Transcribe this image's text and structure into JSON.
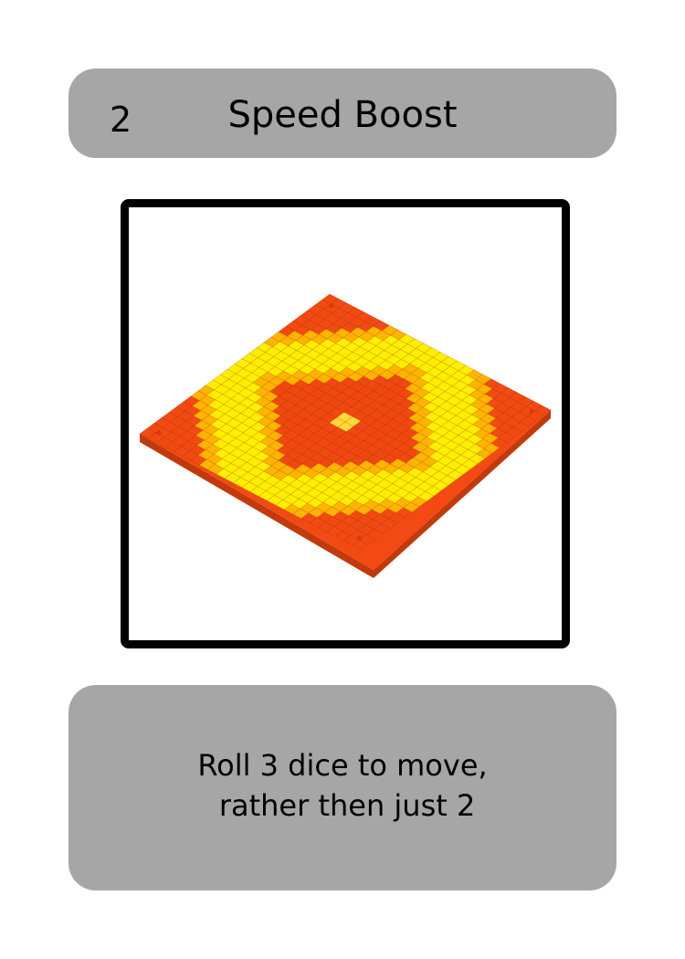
{
  "card": {
    "cost": "2",
    "title": "Speed Boost",
    "artwork": {
      "icon": "speed-boost-tile-icon",
      "tile_grid": 26,
      "colors": {
        "outer": "#f24a12",
        "yellow": "#ffee00",
        "amber": "#ffb400",
        "inner_red": "#f04810",
        "center": "#ffd83a",
        "edge": "#c23a0c"
      }
    },
    "effect_lines": [
      "Roll 3 dice to move,",
      " rather then just 2"
    ]
  },
  "colors": {
    "panel": "#a6a6a6",
    "frame": "#000000",
    "text": "#000000"
  }
}
